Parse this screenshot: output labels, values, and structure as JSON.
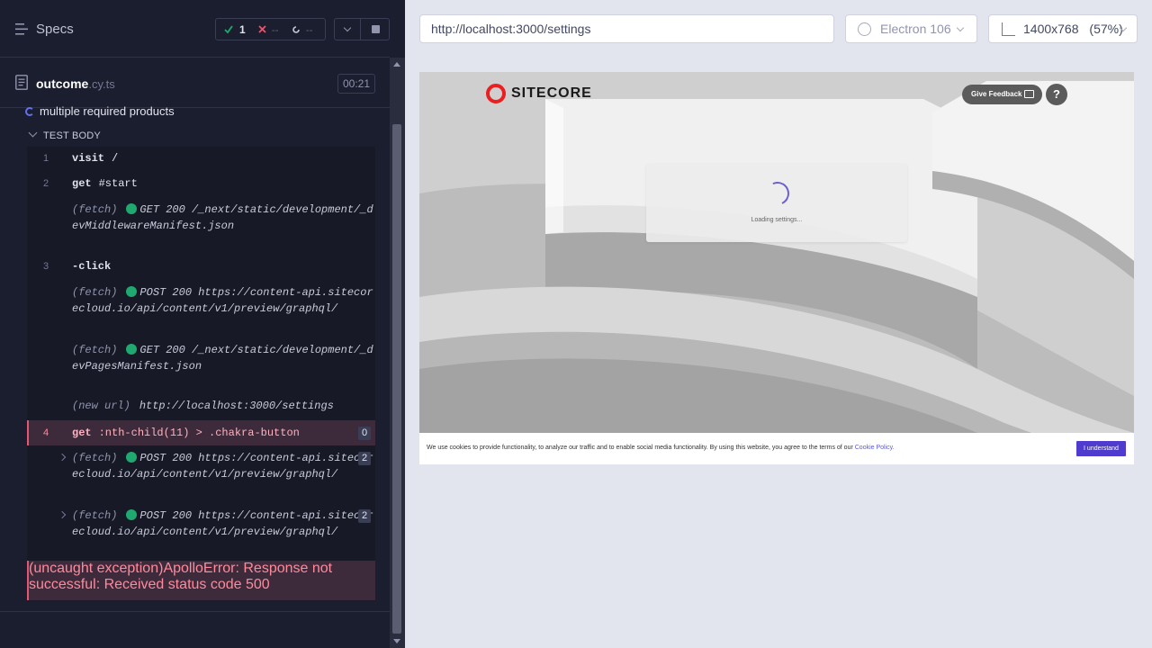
{
  "left_panel": {
    "specs_label": "Specs",
    "stats": {
      "passed": "1",
      "failed": "--",
      "pending": "--"
    },
    "file": {
      "name": "outcome",
      "ext": ".cy.ts",
      "duration": "00:21"
    },
    "test_title": "multiple required products",
    "test_body_label": "TEST BODY",
    "commands": [
      {
        "num": "1",
        "name": "visit",
        "msg": "/"
      },
      {
        "num": "2",
        "name": "get",
        "msg": "#start"
      },
      {
        "label": "(fetch)",
        "text": "GET 200 /_next/static/development/_devMiddlewareManifest.json"
      },
      {
        "num": "3",
        "name": "-click",
        "msg": ""
      },
      {
        "label": "(fetch)",
        "text": "POST 200 https://content-api.sitecorecloud.io/api/content/v1/preview/graphql/"
      },
      {
        "label": "(fetch)",
        "text": "GET 200 /_next/static/development/_devPagesManifest.json"
      },
      {
        "label": "(new url)",
        "text": "http://localhost:3000/settings"
      },
      {
        "num": "4",
        "name": "get",
        "msg": ":nth-child(11) > .chakra-button",
        "badge": "0"
      },
      {
        "label": "(fetch)",
        "text": "POST 200 https://content-api.sitecorecloud.io/api/content/v1/preview/graphql/",
        "badge": "2"
      },
      {
        "label": "(fetch)",
        "text": "POST 200 https://content-api.sitecorecloud.io/api/content/v1/preview/graphql/",
        "badge": "2"
      },
      {
        "label": "(uncaught exception)",
        "text": "ApolloError: Response not successful: Received status code 500"
      }
    ]
  },
  "toolbar": {
    "url": "http://localhost:3000/settings",
    "browser": "Electron 106",
    "viewport": "1400x768",
    "viewport_scale": "(57%)"
  },
  "aut": {
    "logo_text": "SITECORE",
    "feedback_label": "Give Feedback",
    "help_label": "?",
    "loading_text": "Loading settings...",
    "cookie_text": "We use cookies to provide functionality, to analyze our traffic and to enable social media functionality. By using this website, you agree to the terms of our",
    "cookie_link": "Cookie Policy.",
    "cookie_button": "I understand"
  },
  "colors": {
    "panel_bg": "#1b1e2e",
    "pass": "#1fa971",
    "fail": "#e45770",
    "accent": "#6470f3",
    "cookie_button": "#4f3ccf",
    "logo_red": "#eb1f1f"
  },
  "icons": [
    "specs-icon",
    "check-icon",
    "x-icon",
    "pending-icon",
    "chevron-down-icon",
    "stop-icon",
    "file-icon",
    "spinner-icon",
    "electron-icon",
    "ruler-icon",
    "feedback-bubble-icon"
  ]
}
